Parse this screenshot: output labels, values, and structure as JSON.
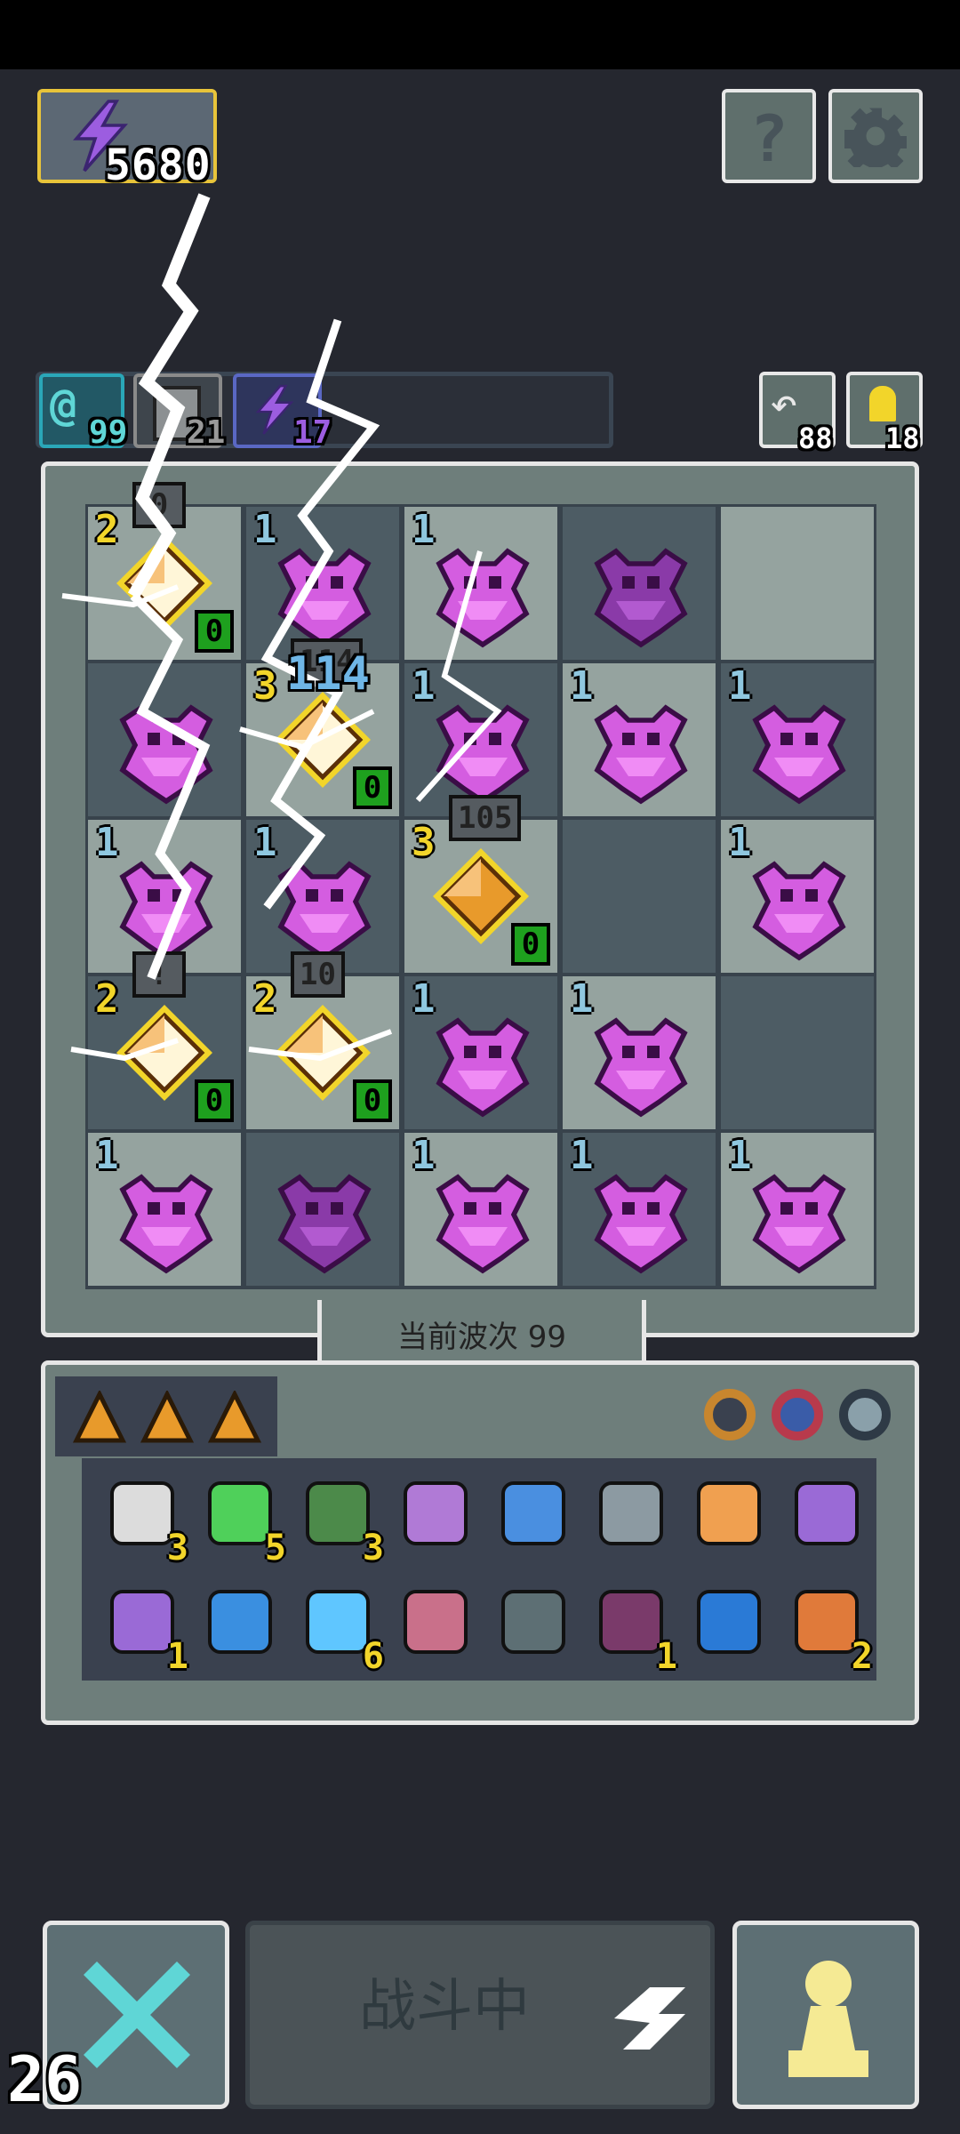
{
  "hud": {
    "energy_value": "5680",
    "help_label": "?",
    "resource_a_value": "99",
    "resource_b_value": "21",
    "resource_c_value": "17",
    "undo_count": "88",
    "key_count": "18",
    "frame_counter": "26"
  },
  "board": {
    "rows": [
      [
        {
          "type": "crystal",
          "level": "2",
          "count": "0",
          "flash": true,
          "tag": "0"
        },
        {
          "type": "demon",
          "level": "1",
          "count": "",
          "flash": false,
          "tag": ""
        },
        {
          "type": "demon",
          "level": "1",
          "count": "",
          "flash": false,
          "tag": ""
        },
        {
          "type": "demon-dark",
          "level": "",
          "count": "",
          "flash": false,
          "tag": ""
        },
        {
          "type": "empty",
          "level": "",
          "count": "",
          "flash": false,
          "tag": ""
        }
      ],
      [
        {
          "type": "demon",
          "level": "",
          "count": "",
          "flash": false,
          "tag": ""
        },
        {
          "type": "crystal",
          "level": "3",
          "count": "0",
          "flash": true,
          "tag": "114"
        },
        {
          "type": "demon",
          "level": "1",
          "count": "",
          "flash": false,
          "tag": ""
        },
        {
          "type": "demon",
          "level": "1",
          "count": "",
          "flash": false,
          "tag": ""
        },
        {
          "type": "demon",
          "level": "1",
          "count": "",
          "flash": false,
          "tag": ""
        }
      ],
      [
        {
          "type": "demon",
          "level": "1",
          "count": "",
          "flash": false,
          "tag": ""
        },
        {
          "type": "demon",
          "level": "1",
          "count": "",
          "flash": false,
          "tag": ""
        },
        {
          "type": "crystal",
          "level": "3",
          "count": "0",
          "flash": false,
          "tag": "105"
        },
        {
          "type": "empty",
          "level": "",
          "count": "",
          "flash": false,
          "tag": ""
        },
        {
          "type": "demon",
          "level": "1",
          "count": "",
          "flash": false,
          "tag": ""
        }
      ],
      [
        {
          "type": "crystal",
          "level": "2",
          "count": "0",
          "flash": true,
          "tag": "!"
        },
        {
          "type": "crystal",
          "level": "2",
          "count": "0",
          "flash": true,
          "tag": "10"
        },
        {
          "type": "demon",
          "level": "1",
          "count": "",
          "flash": false,
          "tag": ""
        },
        {
          "type": "demon",
          "level": "1",
          "count": "",
          "flash": false,
          "tag": ""
        },
        {
          "type": "empty",
          "level": "",
          "count": "",
          "flash": false,
          "tag": ""
        }
      ],
      [
        {
          "type": "demon",
          "level": "1",
          "count": "",
          "flash": false,
          "tag": ""
        },
        {
          "type": "demon-dark",
          "level": "",
          "count": "",
          "flash": false,
          "tag": ""
        },
        {
          "type": "demon",
          "level": "1",
          "count": "",
          "flash": false,
          "tag": ""
        },
        {
          "type": "demon",
          "level": "1",
          "count": "",
          "flash": false,
          "tag": ""
        },
        {
          "type": "demon",
          "level": "1",
          "count": "",
          "flash": false,
          "tag": ""
        }
      ]
    ],
    "damage_popup": "114",
    "wave_label": "当前波次 99"
  },
  "inventory": {
    "row1": [
      {
        "icon": "scroll-icon",
        "count": "3"
      },
      {
        "icon": "green-gem-icon",
        "count": "5"
      },
      {
        "icon": "hooded-figure-icon",
        "count": "3"
      },
      {
        "icon": "magic-staff-icon",
        "count": ""
      },
      {
        "icon": "blue-feather-icon",
        "count": ""
      },
      {
        "icon": "lever-icon",
        "count": ""
      },
      {
        "icon": "key-t-icon",
        "count": ""
      },
      {
        "icon": "bat-icon",
        "count": ""
      }
    ],
    "row2": [
      {
        "icon": "potion-jar-icon",
        "count": "1"
      },
      {
        "icon": "blue-wave-icon",
        "count": ""
      },
      {
        "icon": "blue-orb-icon",
        "count": "6"
      },
      {
        "icon": "arrow-icon",
        "count": ""
      },
      {
        "icon": "spiked-crown-icon",
        "count": ""
      },
      {
        "icon": "demon-mask-icon",
        "count": "1"
      },
      {
        "icon": "water-drop-icon",
        "count": ""
      },
      {
        "icon": "axe-icon",
        "count": "2"
      }
    ]
  },
  "controls": {
    "fight_label": "战斗中"
  },
  "colors": {
    "background": "#25272f",
    "panel": "#6e7e7b",
    "gold": "#f2d52a",
    "demon": "#d45de0",
    "cyan": "#5fd6d6"
  }
}
